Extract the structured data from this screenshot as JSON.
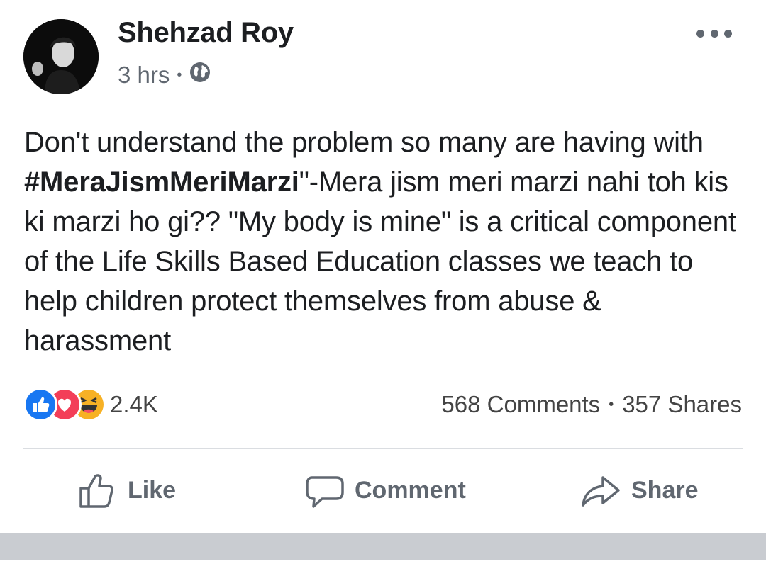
{
  "post": {
    "author": "Shehzad Roy",
    "time": "3 hrs",
    "meta_separator": "•",
    "privacy_icon": "globe-icon",
    "menu_icon": "more-options-icon",
    "text_prefix": "Don't understand the problem so many are having with ",
    "hashtag": "#MeraJismMeriMarzi",
    "text_suffix": "\"-Mera jism meri marzi nahi toh kis ki marzi ho gi?? \"My body is mine\" is a critical component of the Life Skills Based Education classes we teach to help children protect themselves from abuse & harassment"
  },
  "engagement": {
    "reaction_icons": [
      "like-reaction-icon",
      "love-reaction-icon",
      "haha-reaction-icon"
    ],
    "reaction_count": "2.4K",
    "comments": "568 Comments",
    "separator": "•",
    "shares": "357 Shares"
  },
  "actions": {
    "like_label": "Like",
    "comment_label": "Comment",
    "share_label": "Share"
  },
  "colors": {
    "like_blue": "#1877f2",
    "love_red": "#f33e58",
    "haha_yellow": "#f7b125",
    "muted_text": "#606770"
  }
}
